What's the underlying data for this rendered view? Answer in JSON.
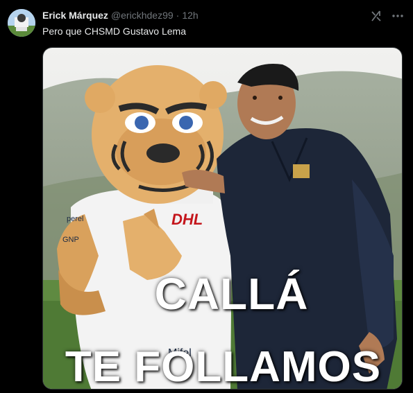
{
  "author": {
    "name": "Erick Márquez",
    "handle": "@erickhdez99",
    "separator": "·",
    "time": "12h"
  },
  "tweet": {
    "text": "Pero que CHSMD Gustavo Lema"
  },
  "icons": {
    "grok": "grok-icon",
    "more": "more-options-icon"
  },
  "media": {
    "caption_line1": "CALLÁ",
    "caption_line2": "TE FOLLAMOS",
    "shirt_sponsor": "DHL",
    "shirt_brand": "perel",
    "shirt_side": "GNP",
    "shirt_lower": "Mifel"
  }
}
